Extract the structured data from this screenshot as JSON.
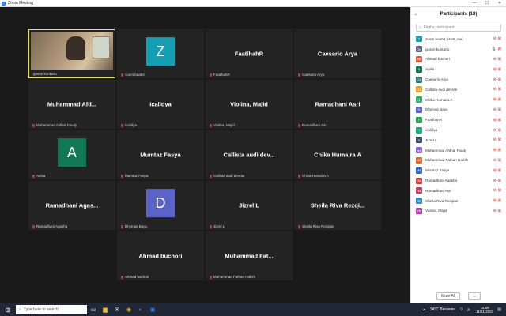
{
  "window": {
    "title": "Zoom Meeting"
  },
  "tiles": [
    {
      "name": "guson kuntarto",
      "big": "",
      "avatar": "",
      "color": "",
      "video": true,
      "active": true
    },
    {
      "name": "zoom baa04",
      "big": "",
      "avatar": "Z",
      "color": "#14a0b4"
    },
    {
      "name": "FaatihahR",
      "big": "FaatihahR"
    },
    {
      "name": "Caesario Arya",
      "big": "Caesario Arya"
    },
    {
      "name": "Muhammad Afdhal Faudy",
      "big": "Muhammad  Afd..."
    },
    {
      "name": "icalidya",
      "big": "icalidya"
    },
    {
      "name": "Violina, Majid",
      "big": "Violina, Majid"
    },
    {
      "name": "Ramadhani Asri",
      "big": "Ramadhani Asri"
    },
    {
      "name": "Anisa",
      "big": "",
      "avatar": "A",
      "color": "#0f7a55"
    },
    {
      "name": "Mumtaz Fasya",
      "big": "Mumtaz Fasya"
    },
    {
      "name": "Callista audi devras",
      "big": "Callista audi dev..."
    },
    {
      "name": "Chika Humaira A",
      "big": "Chika Humaira A"
    },
    {
      "name": "Ramadhani Agasha",
      "big": "Ramadhani  Agas..."
    },
    {
      "name": "Dhymas Bayu",
      "big": "",
      "avatar": "D",
      "color": "#5a64c8"
    },
    {
      "name": "Jizrel L",
      "big": "Jizrel L"
    },
    {
      "name": "Sheila Riva Rezqian",
      "big": "Sheila  Riva  Rezqi..."
    },
    {
      "name": "Ahmad buchori",
      "big": "Ahmad buchori"
    },
    {
      "name": "Muhammad Fathan Hafizh",
      "big": "Muhammad  Fat..."
    }
  ],
  "panel": {
    "title": "Participants (18)",
    "search_placeholder": "Find a participant",
    "participants": [
      {
        "initials": "Z",
        "name": "zoom baa04 (Host, me)",
        "color": "#14a0b4"
      },
      {
        "initials": "GK",
        "name": "guson kuntarto",
        "color": "#5a6478"
      },
      {
        "initials": "AB",
        "name": "Ahmad buchori",
        "color": "#e05a3a"
      },
      {
        "initials": "A",
        "name": "Anisa",
        "color": "#0f7a55"
      },
      {
        "initials": "CA",
        "name": "Caesario Arya",
        "color": "#2d7a6a"
      },
      {
        "initials": "CA",
        "name": "Callista audi devras",
        "color": "#e8a020"
      },
      {
        "initials": "CH",
        "name": "Chika Humaira A",
        "color": "#2db46a"
      },
      {
        "initials": "D",
        "name": "Dhymas Bayu",
        "color": "#5a64c8"
      },
      {
        "initials": "F",
        "name": "FaatihahR",
        "color": "#28a050"
      },
      {
        "initials": "I",
        "name": "icalidya",
        "color": "#1eaa78"
      },
      {
        "initials": "JL",
        "name": "Jizrel L",
        "color": "#3a4a6a"
      },
      {
        "initials": "MA",
        "name": "Muhammad Afdhal Faudy",
        "color": "#8a64d2"
      },
      {
        "initials": "MF",
        "name": "Muhammad Fathan Hafizh",
        "color": "#e06a2a"
      },
      {
        "initials": "MF",
        "name": "Mumtaz Fasya",
        "color": "#2d6ac8"
      },
      {
        "initials": "RA",
        "name": "Ramadhani Agasha",
        "color": "#d23a3a"
      },
      {
        "initials": "RA",
        "name": "Ramadhani Asri",
        "color": "#c83a5a"
      },
      {
        "initials": "SR",
        "name": "Sheila Riva Rezqian",
        "color": "#2d8cc8"
      },
      {
        "initials": "VM",
        "name": "Violina, Majid",
        "color": "#b43ab4"
      }
    ],
    "mute_all": "Mute All",
    "more": "..."
  },
  "taskbar": {
    "search_placeholder": "Type here to search",
    "weather": "34°C  Berawan",
    "time": "15:06",
    "date": "11/21/2022"
  }
}
